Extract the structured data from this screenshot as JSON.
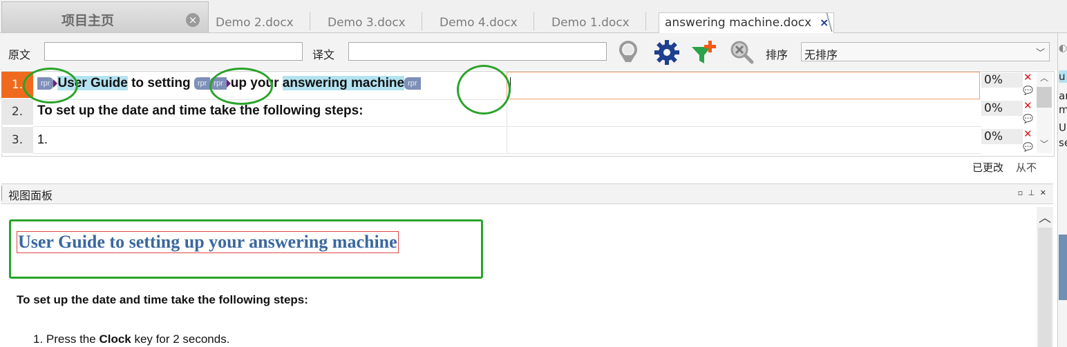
{
  "tabs": {
    "home": "项目主页",
    "docs": [
      "Demo 2.docx",
      "Demo 3.docx",
      "Demo 4.docx",
      "Demo 1.docx"
    ],
    "active": "answering machine.docx",
    "close_glyph": "×"
  },
  "filter": {
    "source_label": "原文",
    "source_value": "",
    "target_label": "译文",
    "target_value": "",
    "sort_label": "排序",
    "sort_value": "无排序",
    "icons": [
      "search-filter-icon",
      "settings-gear-icon",
      "add-filter-icon",
      "clear-search-icon"
    ]
  },
  "segments": [
    {
      "num": "1.",
      "tag_label": "rpr",
      "source_parts": [
        "User Guide",
        " to setting ",
        "up your ",
        "answering machine"
      ],
      "target": "",
      "percent": "0%"
    },
    {
      "num": "2.",
      "source": "To set up the date and time take the following steps:",
      "target": "",
      "percent": "0%"
    },
    {
      "num": "3.",
      "source": "1.",
      "target": "",
      "percent": "0%"
    }
  ],
  "status": {
    "changed": "已更改",
    "never": "从不"
  },
  "view_panel": {
    "title": "视图面板",
    "heading": "User Guide to setting up your answering machine",
    "paragraph": "To set up the date and time take the following steps:",
    "list_item_prefix": "1. Press the ",
    "list_item_bold": "Clock",
    "list_item_suffix": " key for 2 seconds."
  },
  "right_panel": {
    "rows": [
      "u",
      "ar",
      "m",
      "U",
      "se"
    ]
  },
  "colors": {
    "active_row": "#f06a1d",
    "annotation_green": "#2aa32a",
    "tag": "#7e8fb8",
    "highlight": "#b4e2f0",
    "heading_blue": "#3a68a0"
  }
}
